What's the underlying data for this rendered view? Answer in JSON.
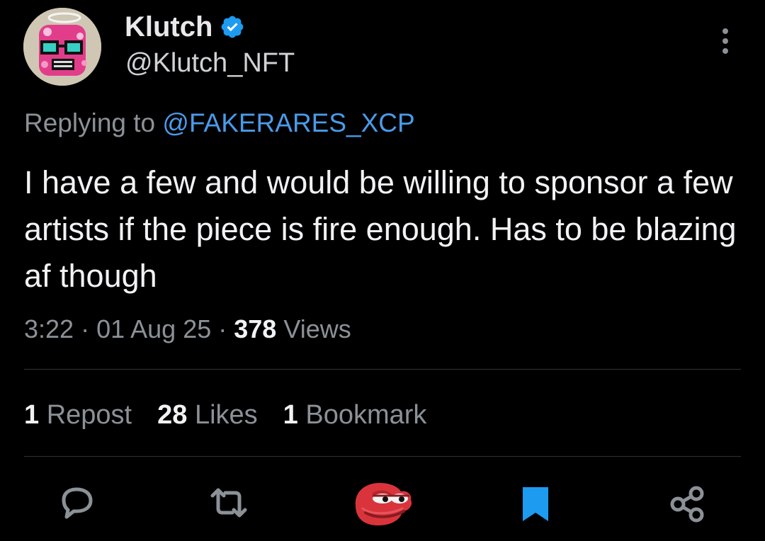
{
  "tweet": {
    "author": {
      "display_name": "Klutch",
      "handle": "@Klutch_NFT",
      "verified_icon": "verified-badge-icon"
    },
    "reply": {
      "prefix": "Replying to ",
      "mention": "@FAKERARES_XCP"
    },
    "text": "I have a few and would be willing to sponsor a few artists if the piece is fire enough. Has to be blazing af though",
    "meta": {
      "time": "3:22",
      "sep1": " · ",
      "date": "01 Aug 25",
      "sep2": " · ",
      "views_count": "378",
      "views_label": " Views"
    },
    "stats": {
      "reposts_count": "1",
      "reposts_label": " Repost",
      "likes_count": "28",
      "likes_label": " Likes",
      "bookmarks_count": "1",
      "bookmarks_label": " Bookmark"
    },
    "actions": {
      "reply_icon": "reply-bubble-icon",
      "repost_icon": "repost-arrows-icon",
      "like_icon": "pepe-reaction-icon",
      "bookmark_icon": "bookmark-filled-icon",
      "share_icon": "share-nodes-icon"
    },
    "more_icon": "more-options-icon"
  },
  "colors": {
    "background": "#000000",
    "text_primary": "#f1f2f3",
    "text_secondary": "#8b9197",
    "link": "#4a9bea",
    "verified": "#1d9bf0",
    "bookmark": "#1d9bf0",
    "divider": "#2f3336",
    "pepe_green": "#d9343c"
  }
}
